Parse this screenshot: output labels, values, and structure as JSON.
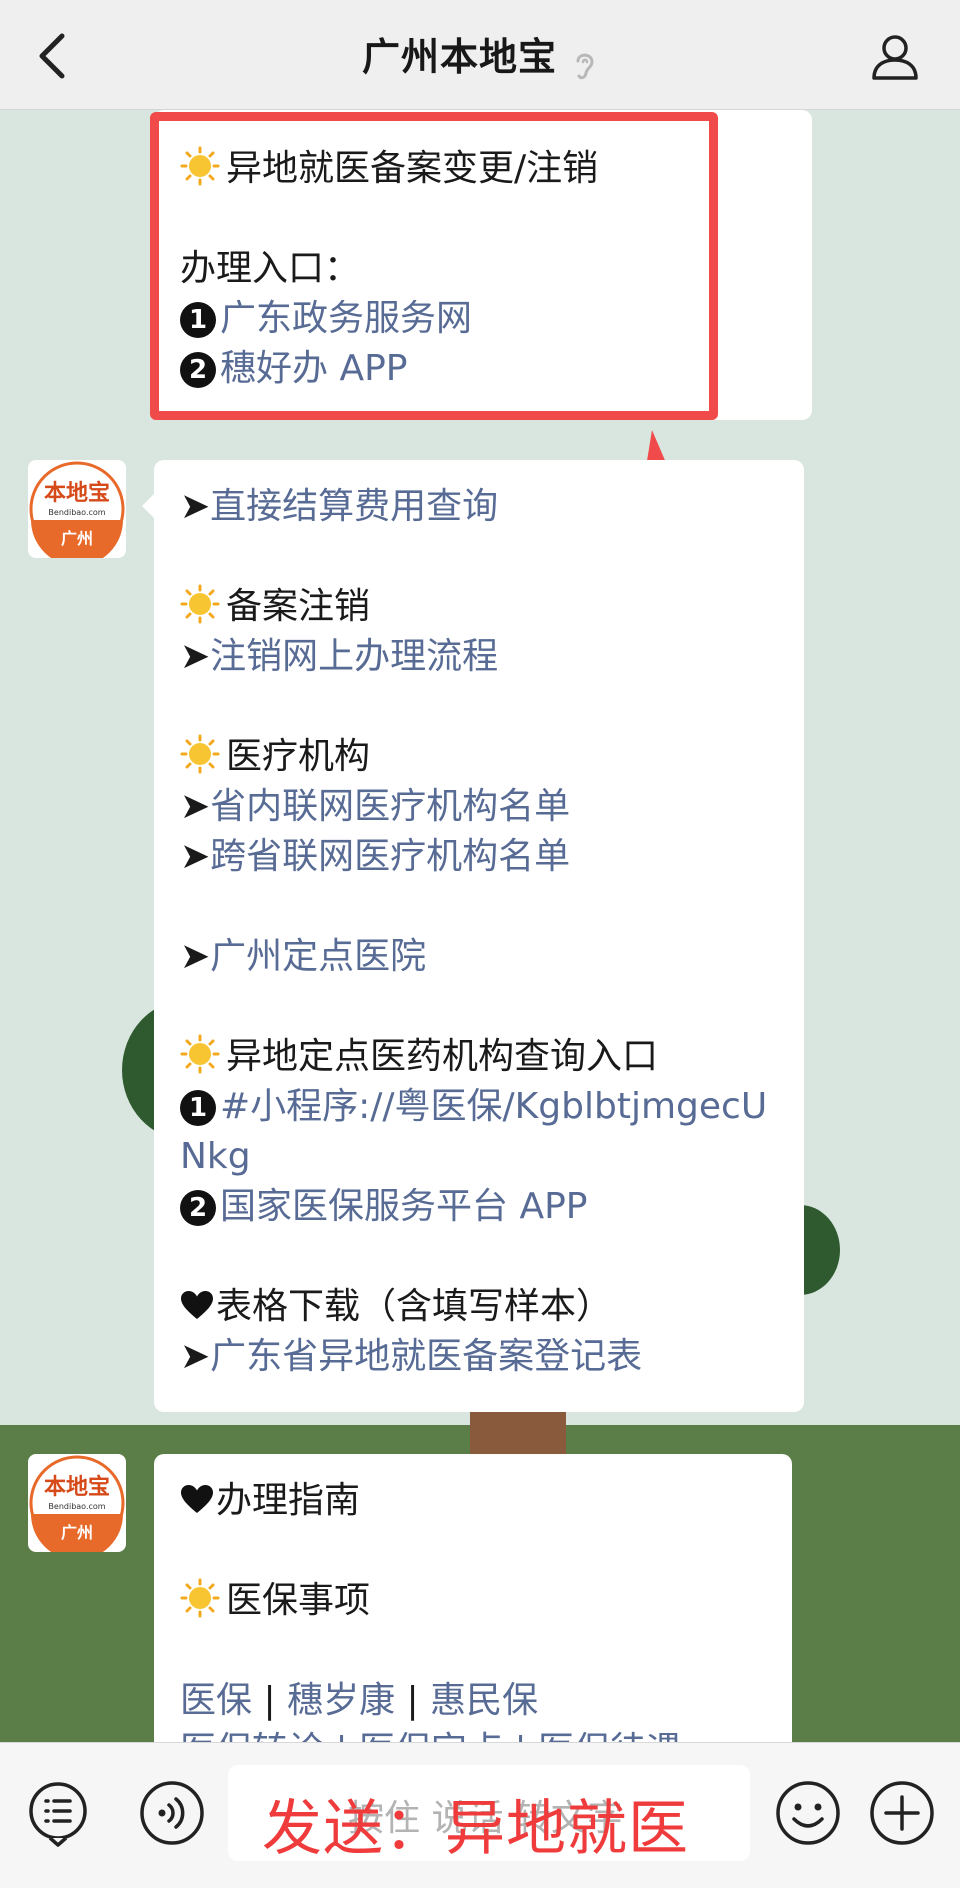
{
  "header": {
    "title": "广州本地宝"
  },
  "messages": {
    "top": {
      "heading": "异地就医备案变更/注销",
      "entry_label": "办理入口：",
      "item1_num": "1",
      "item1": "广东政务服务网",
      "item2_num": "2",
      "item2": "穗好办 APP"
    },
    "second": {
      "l1_arrow": "➤",
      "l1": "直接结算费用查询",
      "h1": "备案注销",
      "l2_arrow": "➤",
      "l2": "注销网上办理流程",
      "h2": "医疗机构",
      "l3_arrow": "➤",
      "l3": "省内联网医疗机构名单",
      "l4_arrow": "➤",
      "l4": "跨省联网医疗机构名单",
      "l5_arrow": "➤",
      "l5": "广州定点医院",
      "h3": "异地定点医药机构查询入口",
      "q1_num": "1",
      "q1": "#小程序://粤医保/KgblbtjmgecUNkg",
      "q2_num": "2",
      "q2": "国家医保服务平台 APP",
      "h4": "表格下载（含填写样本）",
      "l6_arrow": "➤",
      "l6": "广东省异地就医备案登记表"
    },
    "third": {
      "h1": "办理指南",
      "h2": "医保事项",
      "links": [
        "医保",
        "穗岁康",
        "惠民保"
      ],
      "separator": "|",
      "partial": "医保转诊 | 医保定点 | 医保待遇"
    },
    "avatar_text": {
      "top": "本地宝",
      "mid": "Bendibao.com",
      "bottom": "广州"
    }
  },
  "input_bar": {
    "placeholder": "按住 说话 转文字"
  },
  "overlay": {
    "text": "发送：异地就医"
  },
  "colors": {
    "link": "#576b95",
    "annotation_red": "#f04a4a",
    "bubble": "#ffffff",
    "header_bg": "#efefef"
  }
}
